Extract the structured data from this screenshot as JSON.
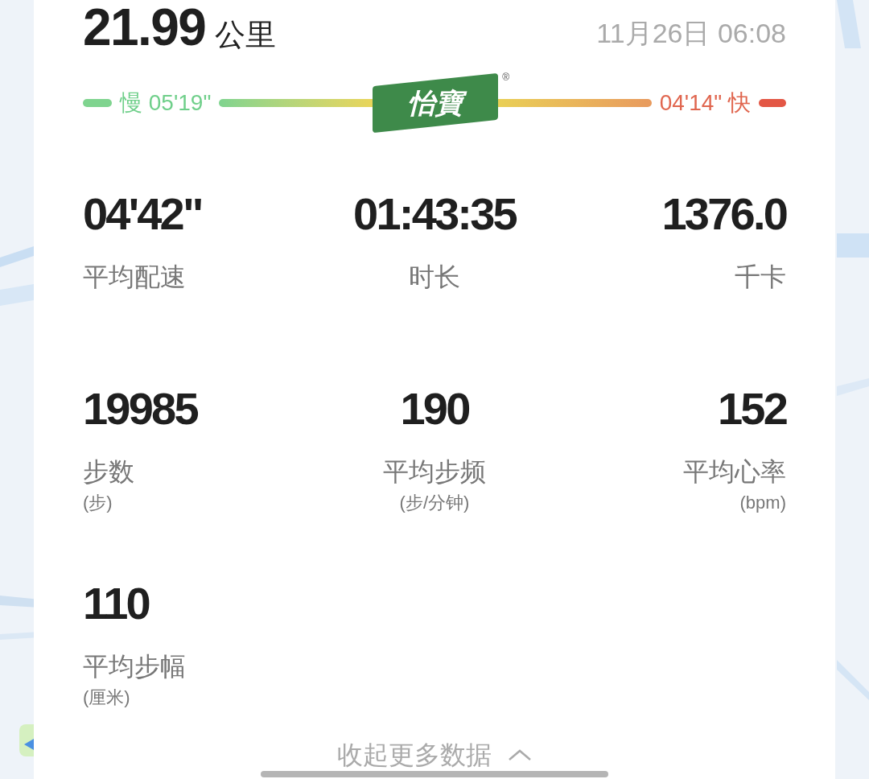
{
  "summary": {
    "distance": "21.99",
    "unit": "公里",
    "datetime": "11月26日 06:08"
  },
  "pace_bar": {
    "slow_label": "慢 05'19\"",
    "fast_label": "04'14\" 快",
    "logo_text": "怡寶",
    "logo_mark": "®"
  },
  "stats": [
    {
      "value": "04'42\"",
      "label": "平均配速"
    },
    {
      "value": "01:43:35",
      "label": "时长"
    },
    {
      "value": "1376.0",
      "label": "千卡"
    },
    {
      "value": "19985",
      "label": "步数",
      "unit": "(步)"
    },
    {
      "value": "190",
      "label": "平均步频",
      "unit": "(步/分钟)"
    },
    {
      "value": "152",
      "label": "平均心率",
      "unit": "(bpm)"
    },
    {
      "value": "110",
      "label": "平均步幅",
      "unit": "(厘米)"
    }
  ],
  "collapse_link": "收起更多数据"
}
